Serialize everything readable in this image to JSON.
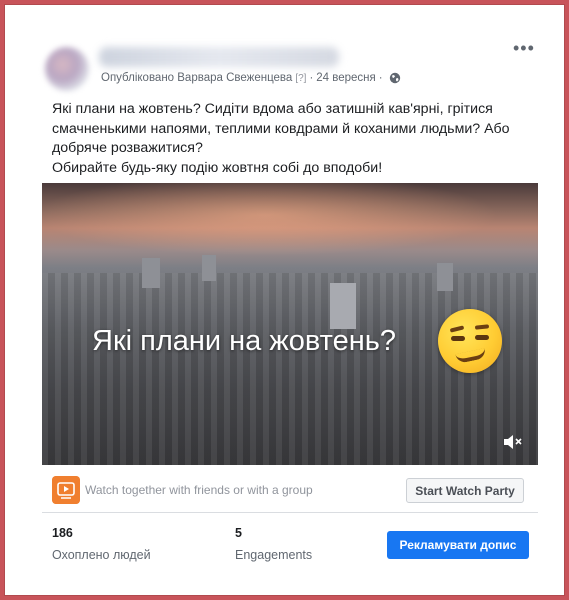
{
  "post": {
    "meta": {
      "published_by": "Опубліковано Варвара Свеженцева",
      "help_marker": "[?]",
      "separator": "·",
      "date": "24 вересня"
    },
    "more_icon": "more-horizontal-icon",
    "text_lines": [
      "Які плани на жовтень? Сидіти вдома або затишній кав'ярні, грітися",
      "смачненькими напоями, теплими ковдрами й коханими людьми? Або",
      "добряче розважитися?",
      "Обирайте будь-яку подію жовтня собі до вподоби!"
    ]
  },
  "video": {
    "caption": "Які плани на жовтень?",
    "emoji": "smirking-face",
    "mute_icon": "speaker-muted-icon"
  },
  "watch_party": {
    "text": "Watch together with friends or with a group",
    "button_label": "Start Watch Party"
  },
  "stats": {
    "reach": {
      "value": "186",
      "label": "Охоплено людей"
    },
    "engagements": {
      "value": "5",
      "label": "Engagements"
    }
  },
  "boost_button_label": "Рекламувати допис",
  "colors": {
    "border": "#c8545a",
    "primary_button": "#1877f2",
    "watch_party_icon": "#f07f2f"
  }
}
